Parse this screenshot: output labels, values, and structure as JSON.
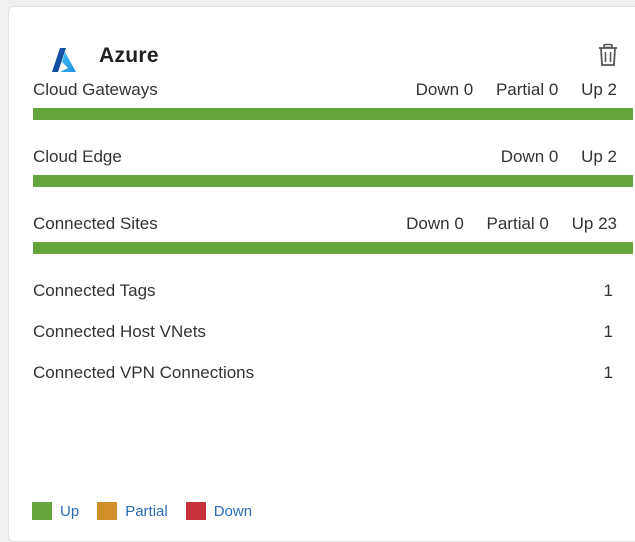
{
  "card": {
    "title": "Azure",
    "logo_icon": "azure-logo-icon",
    "delete_icon": "trash-icon"
  },
  "status_rows": [
    {
      "label": "Cloud Gateways",
      "stats": [
        "Down 0",
        "Partial 0",
        "Up 2"
      ],
      "up_fraction": 1.0
    },
    {
      "label": "Cloud Edge",
      "stats": [
        "Down 0",
        "Up 2"
      ],
      "up_fraction": 1.0
    },
    {
      "label": "Connected Sites",
      "stats": [
        "Down 0",
        "Partial 0",
        "Up 23"
      ],
      "up_fraction": 1.0
    }
  ],
  "info_rows": [
    {
      "label": "Connected Tags",
      "value": "1"
    },
    {
      "label": "Connected Host VNets",
      "value": "1"
    },
    {
      "label": "Connected VPN Connections",
      "value": "1"
    }
  ],
  "legend": [
    {
      "label": "Up",
      "color": "#65a63c"
    },
    {
      "label": "Partial",
      "color": "#d08e2b"
    },
    {
      "label": "Down",
      "color": "#c8333a"
    }
  ],
  "colors": {
    "up": "#65a63c",
    "partial": "#d08e2b",
    "down": "#c8333a",
    "azure_blue": "#1a66c8"
  }
}
